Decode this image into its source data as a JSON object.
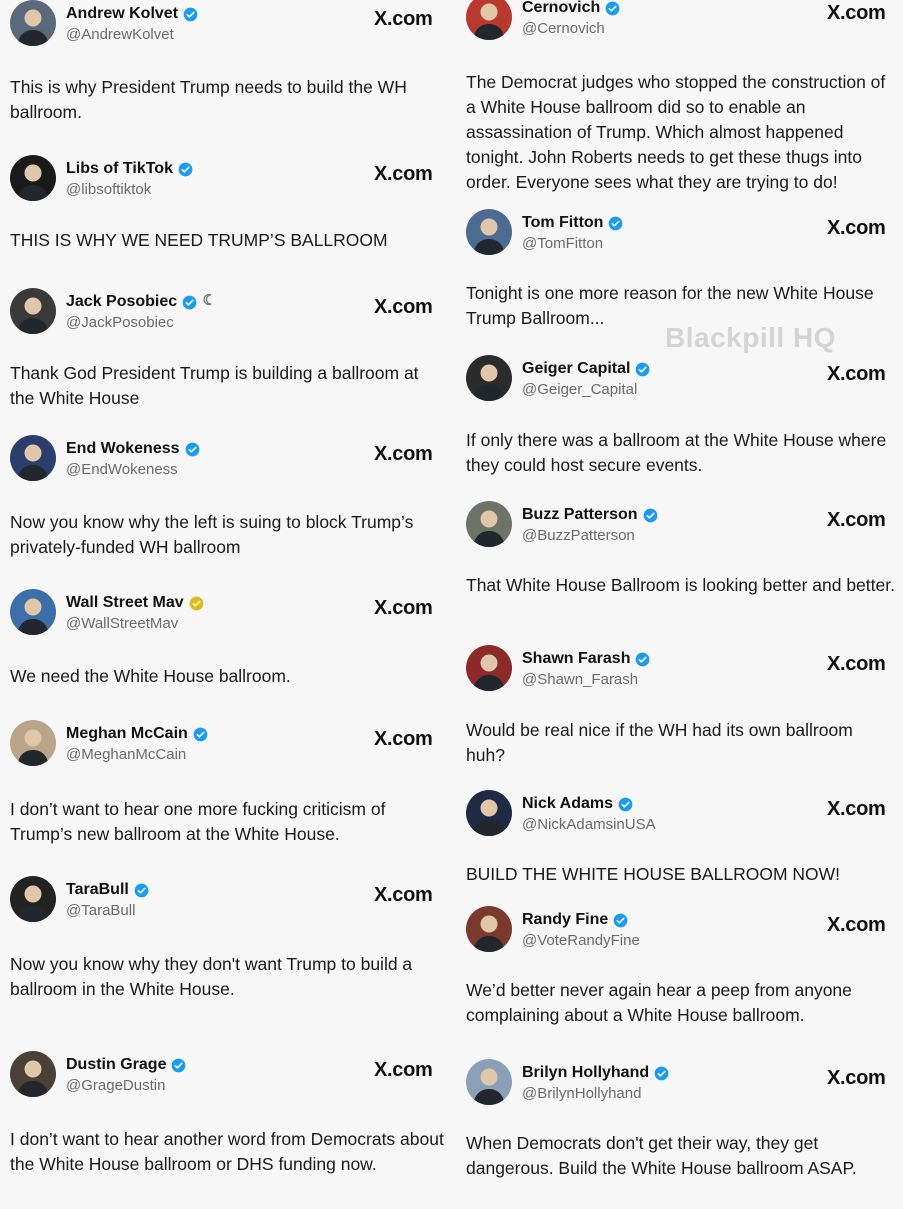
{
  "watermark": "Blackpill HQ",
  "source_label": "X.com",
  "colors": {
    "verified_blue": "#1d9bf0",
    "verified_gold": "#e2b719",
    "text": "#0f1419",
    "handle": "#6b6b6b",
    "background": "#f7f7f7"
  },
  "left_column": [
    {
      "name": "Andrew Kolvet",
      "handle": "@AndrewKolvet",
      "badge": "blue",
      "extra_icon": "",
      "text": "This is why President Trump needs to build the WH ballroom.",
      "avatar_color": "#5b6a7a",
      "avatar_icon": "person-photo-icon"
    },
    {
      "name": "Libs of TikTok",
      "handle": "@libsoftiktok",
      "badge": "blue",
      "extra_icon": "",
      "text": "THIS IS WHY WE NEED TRUMP’S BALLROOM",
      "avatar_color": "#1a1a1a",
      "avatar_icon": "libs-of-tiktok-logo-icon"
    },
    {
      "name": "Jack Posobiec",
      "handle": "@JackPosobiec",
      "badge": "blue",
      "extra_icon": "crescent-moon-icon",
      "text": "Thank God President Trump is building a ballroom at the White House",
      "avatar_color": "#3a3a3a",
      "avatar_icon": "person-photo-icon"
    },
    {
      "name": "End Wokeness",
      "handle": "@EndWokeness",
      "badge": "blue",
      "extra_icon": "",
      "text": "Now you know why the left is suing to block Trump’s privately-funded WH ballroom",
      "avatar_color": "#2c3e6b",
      "avatar_icon": "end-wokeness-logo-icon"
    },
    {
      "name": "Wall Street Mav",
      "handle": "@WallStreetMav",
      "badge": "gold",
      "extra_icon": "",
      "text": "We need the White House ballroom.",
      "avatar_color": "#3c6fa8",
      "avatar_icon": "cartoon-avatar-icon"
    },
    {
      "name": "Meghan McCain",
      "handle": "@MeghanMcCain",
      "badge": "blue",
      "extra_icon": "",
      "text": "I don’t want to hear one more fucking criticism of Trump’s new ballroom at the White House.",
      "avatar_color": "#b9a58a",
      "avatar_icon": "person-photo-icon"
    },
    {
      "name": "TaraBull",
      "handle": "@TaraBull",
      "badge": "blue",
      "extra_icon": "",
      "text": "Now you know why they don't want Trump to build a ballroom in the White House.",
      "avatar_color": "#222222",
      "avatar_icon": "person-photo-icon"
    },
    {
      "name": "Dustin Grage",
      "handle": "@GrageDustin",
      "badge": "blue",
      "extra_icon": "",
      "text": "I don’t want to hear another word from Democrats about the White House ballroom or DHS funding now.",
      "avatar_color": "#4a4036",
      "avatar_icon": "person-photo-icon"
    }
  ],
  "right_column": [
    {
      "name": "Cernovich",
      "handle": "@Cernovich",
      "badge": "blue",
      "extra_icon": "",
      "text": "The Democrat judges who stopped the construction of a White House ballroom did so to enable an assassination of Trump. Which almost happened tonight. John Roberts needs to get these thugs into order. Everyone sees what they are trying to do!",
      "avatar_color": "#b83a2e",
      "avatar_icon": "person-photo-icon"
    },
    {
      "name": "Tom Fitton",
      "handle": "@TomFitton",
      "badge": "blue",
      "extra_icon": "",
      "text": "Tonight is one more reason for the new White House Trump Ballroom...",
      "avatar_color": "#4d6a92",
      "avatar_icon": "person-photo-icon"
    },
    {
      "name": "Geiger Capital",
      "handle": "@Geiger_Capital",
      "badge": "blue",
      "extra_icon": "",
      "text": "If only there was a ballroom at the White House where they could host secure events.",
      "avatar_color": "#2b2b2b",
      "avatar_icon": "person-photo-icon"
    },
    {
      "name": "Buzz Patterson",
      "handle": "@BuzzPatterson",
      "badge": "blue",
      "extra_icon": "",
      "text": "That White House Ballroom is looking better and better.",
      "avatar_color": "#6d7366",
      "avatar_icon": "person-photo-icon"
    },
    {
      "name": "Shawn Farash",
      "handle": "@Shawn_Farash",
      "badge": "blue",
      "extra_icon": "",
      "text": "Would be real nice if the WH had its own ballroom huh?",
      "avatar_color": "#8c2a2a",
      "avatar_icon": "person-photo-icon"
    },
    {
      "name": "Nick Adams",
      "handle": "@NickAdamsinUSA",
      "badge": "blue",
      "extra_icon": "",
      "text": "BUILD THE WHITE HOUSE BALLROOM NOW!",
      "avatar_color": "#1f2a44",
      "avatar_icon": "person-photo-icon"
    },
    {
      "name": "Randy Fine",
      "handle": "@VoteRandyFine",
      "badge": "blue",
      "extra_icon": "",
      "text": "We’d better never again hear a peep from anyone complaining about a White House ballroom.",
      "avatar_color": "#7a3b2e",
      "avatar_icon": "person-photo-icon"
    },
    {
      "name": "Brilyn Hollyhand",
      "handle": "@BrilynHollyhand",
      "badge": "blue",
      "extra_icon": "",
      "text": "When Democrats don't get their way, they get dangerous. Build the White House ballroom ASAP.",
      "avatar_color": "#8aa0b8",
      "avatar_icon": "person-photo-icon"
    }
  ]
}
